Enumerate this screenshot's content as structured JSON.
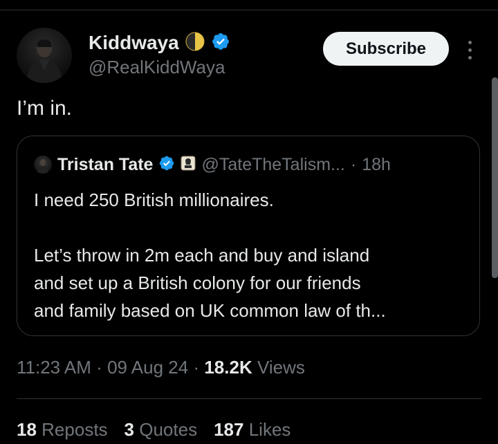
{
  "author": {
    "display_name": "Kiddwaya",
    "handle": "@RealKiddWaya",
    "badge_icon": "half-moon-icon",
    "verified_icon": "verified-badge-icon"
  },
  "actions": {
    "subscribe_label": "Subscribe",
    "more_icon": "more-vertical-icon"
  },
  "tweet": {
    "text": "I’m in.",
    "timestamp_time": "11:23 AM",
    "separator": "·",
    "timestamp_date": "09 Aug 24",
    "views_count": "18.2K",
    "views_label": "Views"
  },
  "quote": {
    "display_name": "Tristan Tate",
    "verified_icon": "verified-badge-icon",
    "affiliation_icon": "affiliate-badge-icon",
    "handle": "@TateTheTalism...",
    "separator": "·",
    "time": "18h",
    "line1": "I need 250 British millionaires.",
    "line2": "Let’s throw in 2m each and buy and island",
    "line3": "and set up a British colony for our friends",
    "line4": "and family based on UK common law of th..."
  },
  "stats": {
    "reposts_count": "18",
    "reposts_label": "Reposts",
    "quotes_count": "3",
    "quotes_label": "Quotes",
    "likes_count": "187",
    "likes_label": "Likes"
  },
  "colors": {
    "background": "#000000",
    "text_primary": "#e7e9ea",
    "text_secondary": "#71767b",
    "verified_blue": "#1d9bf0",
    "divider": "#2f3336",
    "button_bg": "#eff3f4"
  }
}
